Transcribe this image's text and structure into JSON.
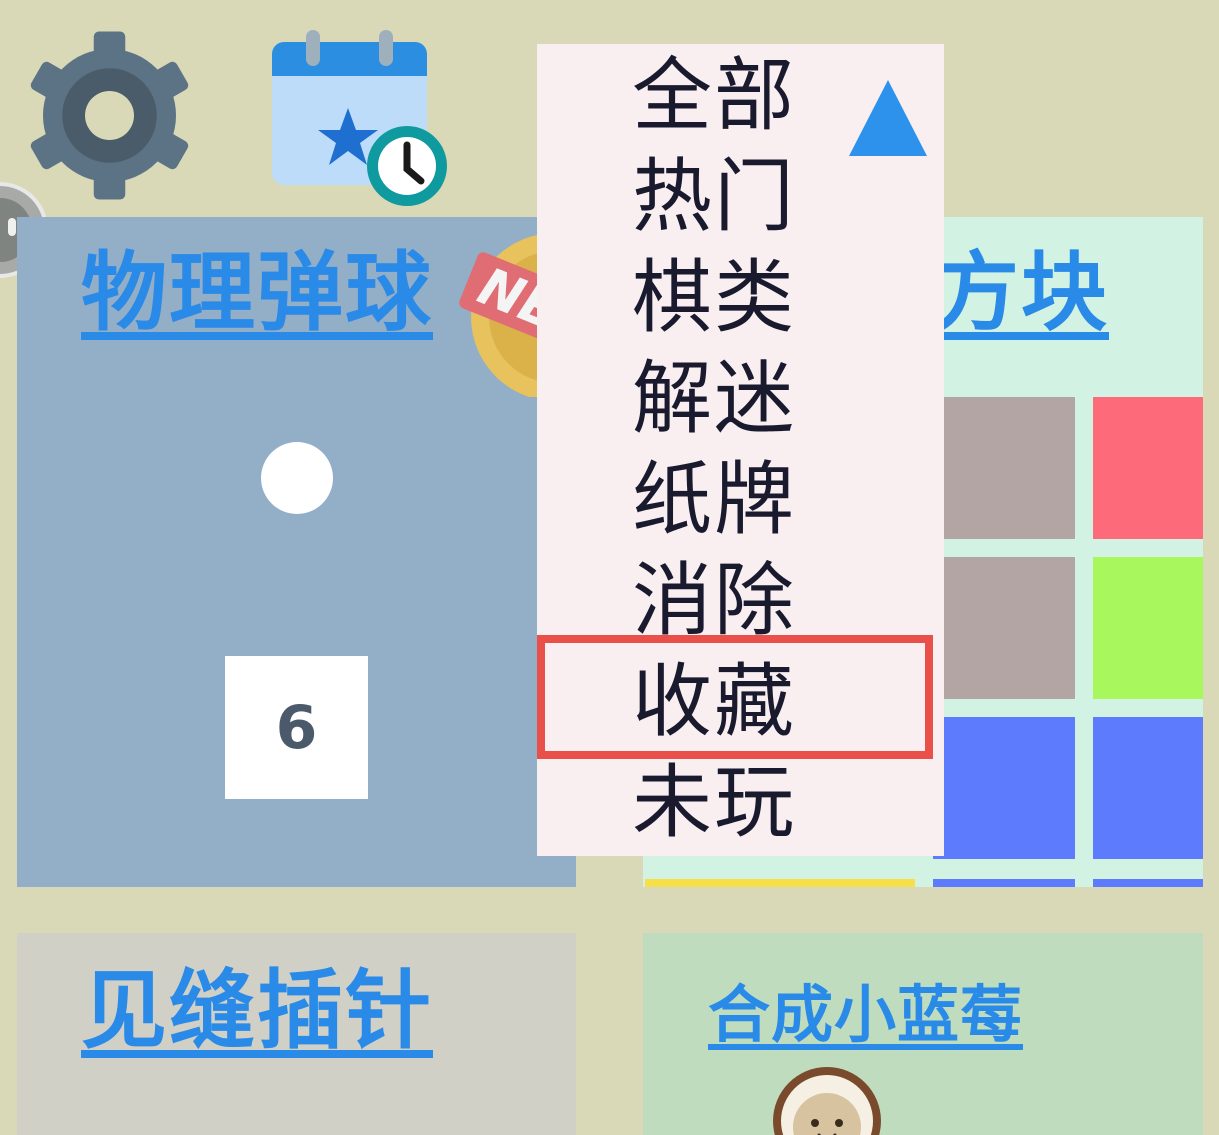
{
  "toolbar": {
    "settings_icon": "gear-icon",
    "calendar_icon": "calendar-star-clock-icon"
  },
  "cards": {
    "physics": {
      "title": "物理弹球",
      "badge": "NE",
      "block_number": "6"
    },
    "blocks": {
      "title": "方块",
      "grid_colors": [
        "#b2a5a4",
        "#fd6b7b",
        "#b2a5a4",
        "#a8f85d",
        "#5c7cfd",
        "#5c7cfd"
      ]
    },
    "pin": {
      "title": "见缝插针"
    },
    "berry": {
      "title": "合成小蓝莓"
    }
  },
  "dropdown": {
    "items": [
      "全部",
      "热门",
      "棋类",
      "解迷",
      "纸牌",
      "消除",
      "收藏",
      "未玩"
    ],
    "highlighted_item": "收藏",
    "caret_icon": "triangle-up-icon"
  },
  "colors": {
    "accent": "#2a8ae8",
    "highlight": "#e85049",
    "background": "#d9d8b7"
  }
}
